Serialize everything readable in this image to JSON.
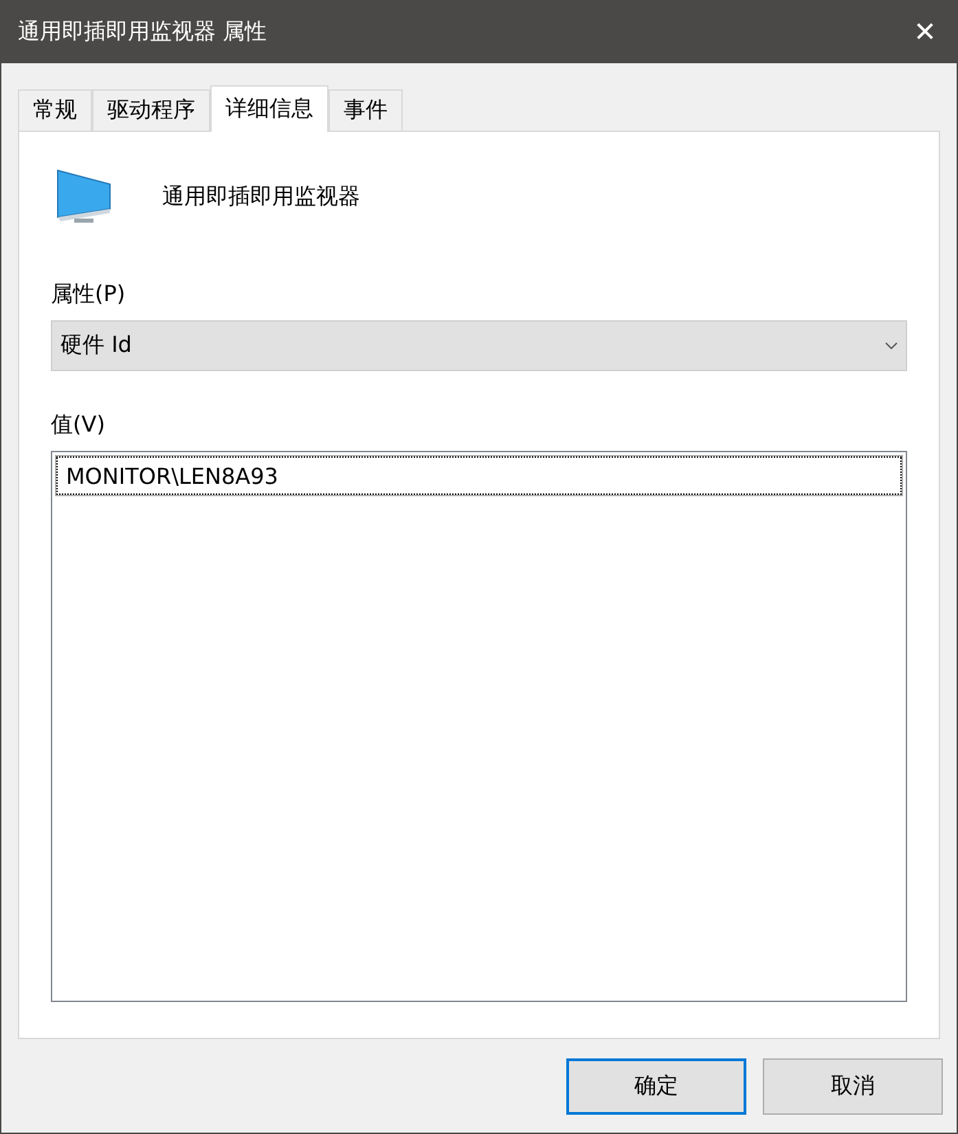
{
  "window": {
    "title": "通用即插即用监视器 属性",
    "close": "✕"
  },
  "tabs": [
    {
      "label": "常规",
      "selected": false
    },
    {
      "label": "驱动程序",
      "selected": false
    },
    {
      "label": "详细信息",
      "selected": true
    },
    {
      "label": "事件",
      "selected": false
    }
  ],
  "device": {
    "name": "通用即插即用监视器"
  },
  "property": {
    "label": "属性(P)",
    "value": "硬件 Id"
  },
  "values": {
    "label": "值(V)",
    "items": [
      {
        "text": "MONITOR\\LEN8A93",
        "selected": true
      }
    ]
  },
  "buttons": [
    {
      "label": "确定",
      "default": true
    },
    {
      "label": "取消",
      "default": false
    }
  ]
}
